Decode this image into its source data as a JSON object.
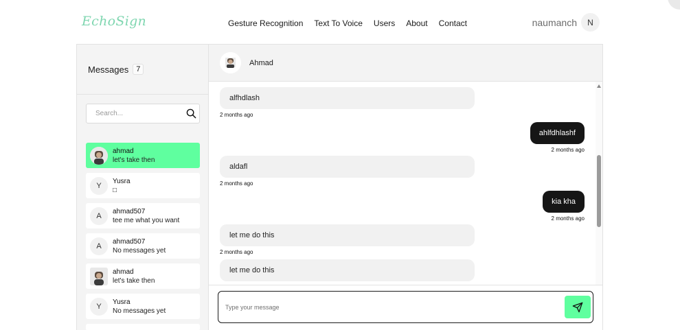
{
  "header": {
    "logo_text": "EchoSign",
    "nav": [
      "Gesture Recognition",
      "Text To Voice",
      "Users",
      "About",
      "Contact"
    ],
    "username": "naumanch",
    "user_initial": "N"
  },
  "sidebar": {
    "title": "Messages",
    "count": "7",
    "search_placeholder": "Search...",
    "conversations": [
      {
        "name": "ahmad",
        "preview": "let's take then",
        "avatar": "photo",
        "initial": "",
        "active": true
      },
      {
        "name": "Yusra",
        "preview": "□",
        "avatar": "letter",
        "initial": "Y",
        "active": false
      },
      {
        "name": "ahmad507",
        "preview": "tee me what you want",
        "avatar": "letter",
        "initial": "A",
        "active": false
      },
      {
        "name": "ahmad507",
        "preview": "No messages yet",
        "avatar": "letter",
        "initial": "A",
        "active": false
      },
      {
        "name": "ahmad",
        "preview": "let's take then",
        "avatar": "photo",
        "initial": "",
        "active": false
      },
      {
        "name": "Yusra",
        "preview": "No messages yet",
        "avatar": "letter",
        "initial": "Y",
        "active": false
      }
    ]
  },
  "chat": {
    "contact_name": "Ahmad",
    "messages": [
      {
        "text": "alfhdlash",
        "direction": "in",
        "time": "2 months ago"
      },
      {
        "text": "ahlfdhlashf",
        "direction": "out",
        "time": "2 months ago"
      },
      {
        "text": "aldafl",
        "direction": "in",
        "time": "2 months ago"
      },
      {
        "text": "kia kha",
        "direction": "out",
        "time": "2 months ago"
      },
      {
        "text": "let me do this",
        "direction": "in",
        "time": "2 months ago"
      },
      {
        "text": "let me do this",
        "direction": "in",
        "time": ""
      }
    ],
    "composer_placeholder": "Type your message"
  },
  "colors": {
    "accent": "#5fff9f",
    "logo": "#7fd6b0",
    "bubble_out": "#161616",
    "bubble_in": "#f1f1f1"
  },
  "icons": {
    "search": "search-icon",
    "send": "send-icon"
  }
}
